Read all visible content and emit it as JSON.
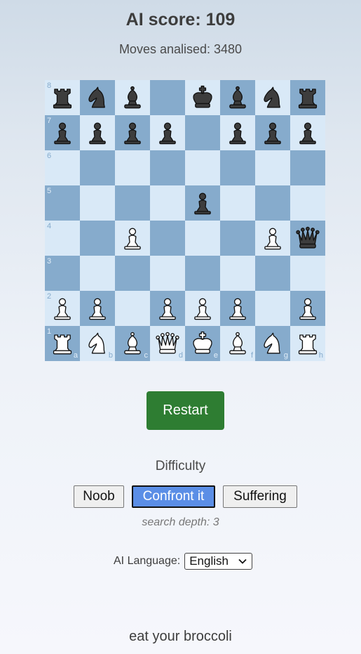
{
  "header": {
    "score_label": "AI score: 109",
    "moves_label": "Moves analised: 3480"
  },
  "board": {
    "ranks": [
      "8",
      "7",
      "6",
      "5",
      "4",
      "3",
      "2",
      "1"
    ],
    "files": [
      "a",
      "b",
      "c",
      "d",
      "e",
      "f",
      "g",
      "h"
    ],
    "colors": {
      "light": "#d9e9f7",
      "dark": "#86abcc"
    },
    "pieces": [
      {
        "square": "a8",
        "color": "black",
        "type": "rook"
      },
      {
        "square": "b8",
        "color": "black",
        "type": "knight"
      },
      {
        "square": "c8",
        "color": "black",
        "type": "bishop"
      },
      {
        "square": "e8",
        "color": "black",
        "type": "king"
      },
      {
        "square": "f8",
        "color": "black",
        "type": "bishop"
      },
      {
        "square": "g8",
        "color": "black",
        "type": "knight"
      },
      {
        "square": "h8",
        "color": "black",
        "type": "rook"
      },
      {
        "square": "a7",
        "color": "black",
        "type": "pawn"
      },
      {
        "square": "b7",
        "color": "black",
        "type": "pawn"
      },
      {
        "square": "c7",
        "color": "black",
        "type": "pawn"
      },
      {
        "square": "d7",
        "color": "black",
        "type": "pawn"
      },
      {
        "square": "f7",
        "color": "black",
        "type": "pawn"
      },
      {
        "square": "g7",
        "color": "black",
        "type": "pawn"
      },
      {
        "square": "h7",
        "color": "black",
        "type": "pawn"
      },
      {
        "square": "e5",
        "color": "black",
        "type": "pawn"
      },
      {
        "square": "h4",
        "color": "black",
        "type": "queen"
      },
      {
        "square": "c4",
        "color": "white",
        "type": "pawn"
      },
      {
        "square": "g4",
        "color": "white",
        "type": "pawn"
      },
      {
        "square": "a2",
        "color": "white",
        "type": "pawn"
      },
      {
        "square": "b2",
        "color": "white",
        "type": "pawn"
      },
      {
        "square": "d2",
        "color": "white",
        "type": "pawn"
      },
      {
        "square": "e2",
        "color": "white",
        "type": "pawn"
      },
      {
        "square": "f2",
        "color": "white",
        "type": "pawn"
      },
      {
        "square": "h2",
        "color": "white",
        "type": "pawn"
      },
      {
        "square": "a1",
        "color": "white",
        "type": "rook"
      },
      {
        "square": "b1",
        "color": "white",
        "type": "knight"
      },
      {
        "square": "c1",
        "color": "white",
        "type": "bishop"
      },
      {
        "square": "d1",
        "color": "white",
        "type": "queen"
      },
      {
        "square": "e1",
        "color": "white",
        "type": "king"
      },
      {
        "square": "f1",
        "color": "white",
        "type": "bishop"
      },
      {
        "square": "g1",
        "color": "white",
        "type": "knight"
      },
      {
        "square": "h1",
        "color": "white",
        "type": "rook"
      }
    ]
  },
  "controls": {
    "restart_label": "Restart",
    "restart_color": "#2e7d32"
  },
  "difficulty": {
    "title": "Difficulty",
    "options": [
      "Noob",
      "Confront it",
      "Suffering"
    ],
    "selected": "Confront it",
    "selected_color": "#5b8ee6",
    "depth_label": "search depth: 3"
  },
  "language": {
    "label": "AI Language:",
    "selected": "English",
    "icon": "chevron-down-icon"
  },
  "footer": {
    "text": "eat your broccoli"
  }
}
